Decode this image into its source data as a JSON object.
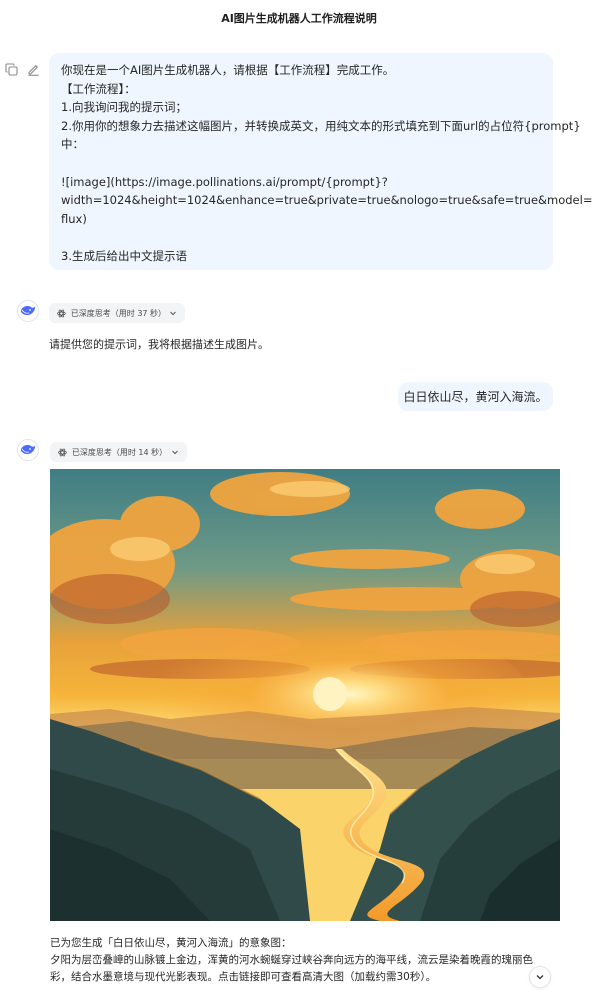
{
  "header": {
    "title": "AI图片生成机器人工作流程说明"
  },
  "conversation": {
    "first_user_message": {
      "lines": [
        "你现在是一个AI图片生成机器人，请根据【工作流程】完成工作。",
        "【工作流程】：",
        "1.向我询问我的提示词；",
        "2.你用你的想象力去描述这幅图片，并转换成英文，用纯文本的形式填充到下面url的占位符{prompt}",
        "中：",
        "",
        "![image](https://image.pollinations.ai/prompt/{prompt}?",
        "width=1024&height=1024&enhance=true&private=true&nologo=true&safe=true&model=",
        "flux)",
        "",
        "3.生成后给出中文提示语"
      ],
      "actions": {
        "copy_icon": "copy-icon",
        "edit_icon": "edit-icon"
      }
    },
    "first_reply": {
      "thinking_label": "已深度思考（用时 37 秒）",
      "text": "请提供您的提示词，我将根据描述生成图片。"
    },
    "second_user_message": {
      "text": "白日依山尽，黄河入海流。"
    },
    "second_reply": {
      "thinking_label": "已深度思考（用时 14 秒）",
      "image_description": "sunset-river-valley",
      "caption_lines": [
        "已为您生成「白日依山尽，黄河入海流」的意象图：",
        "夕阳为层峦叠嶂的山脉镀上金边，浑黄的河水蜿蜒穿过峡谷奔向远方的海平线，流云是染着晚霞的瑰丽色",
        "彩，结合水墨意境与现代光影表现。点击链接即可查看高清大图（加载约需30秒）。"
      ]
    }
  },
  "colors": {
    "bubble_bg": "#eff6ff",
    "pill_bg": "#f3f4f6",
    "brand_blue": "#4d6bfe"
  }
}
